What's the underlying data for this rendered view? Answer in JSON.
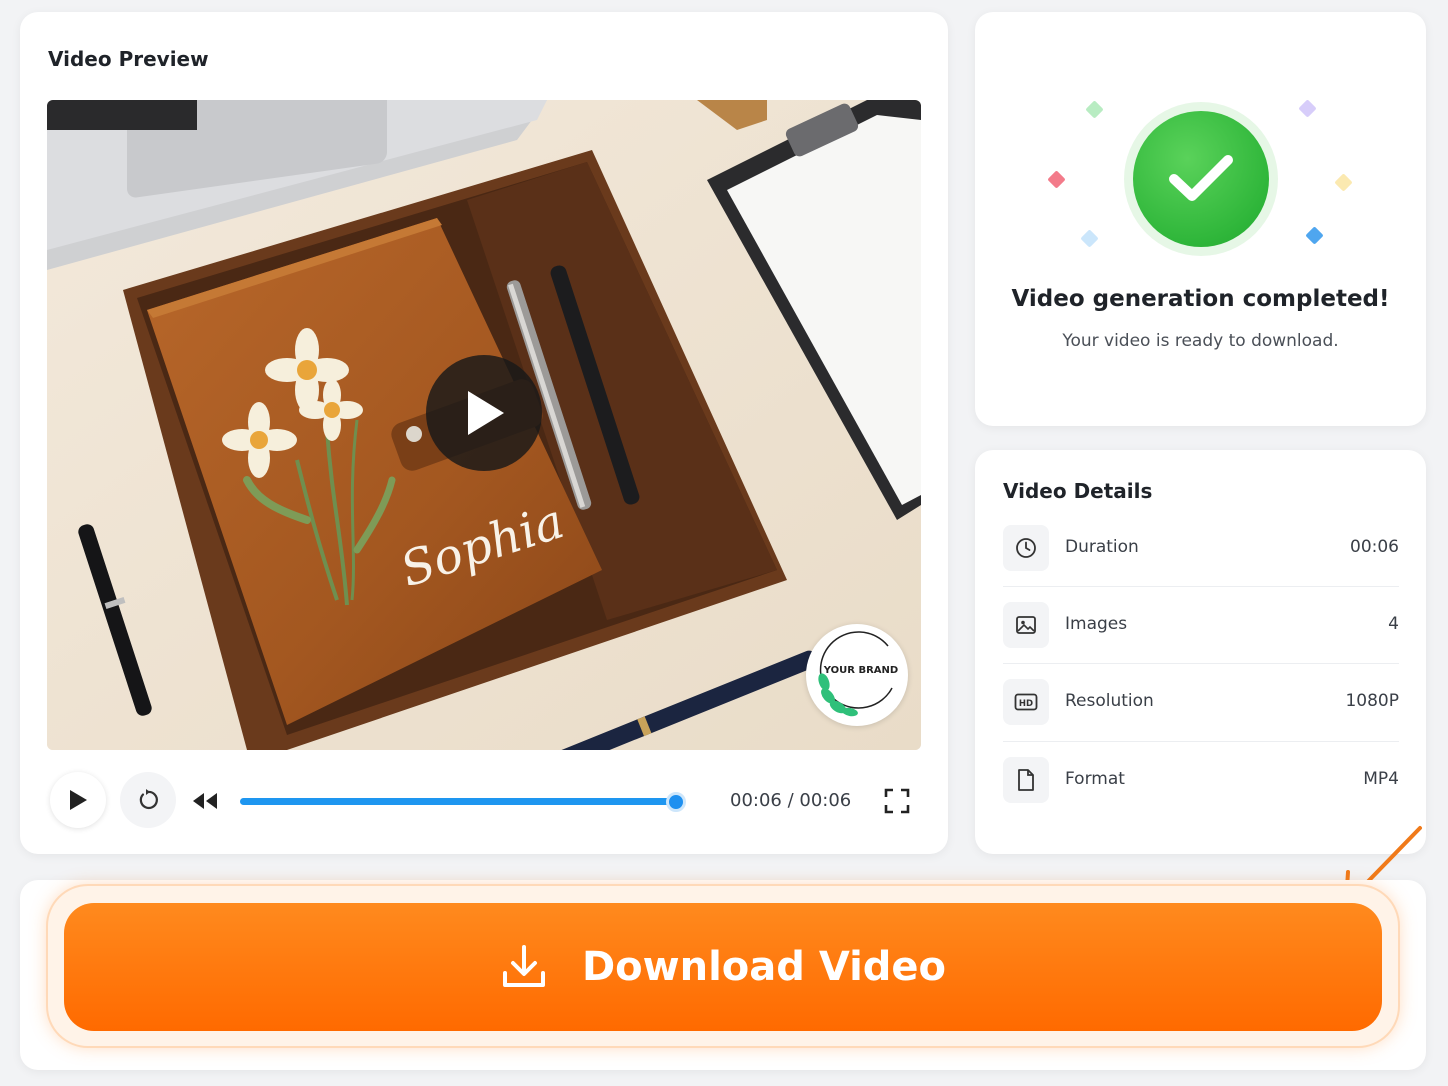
{
  "preview": {
    "title": "Video Preview",
    "script_text": "Sophia",
    "brand_badge": "YOUR BRAND",
    "progress_fraction": 1.0,
    "time": "00:06 / 00:06"
  },
  "success": {
    "title": "Video generation completed!",
    "subtitle": "Your video is ready to download."
  },
  "details": {
    "title": "Video Details",
    "rows": [
      {
        "label": "Duration",
        "value": "00:06",
        "icon": "clock-icon"
      },
      {
        "label": "Images",
        "value": "4",
        "icon": "image-icon"
      },
      {
        "label": "Resolution",
        "value": "1080P",
        "icon": "hd-icon"
      },
      {
        "label": "Format",
        "value": "MP4",
        "icon": "file-icon"
      }
    ]
  },
  "download": {
    "label": "Download Video"
  },
  "colors": {
    "accent_orange": "#ff7a10",
    "progress_blue": "#1e96f0",
    "success_green": "#2fb63a"
  }
}
